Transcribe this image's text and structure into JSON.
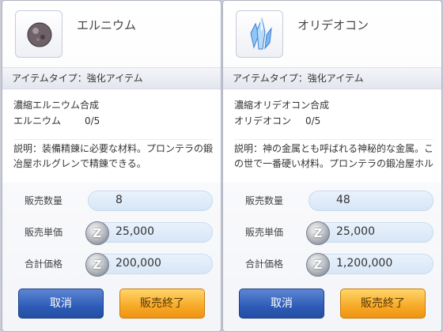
{
  "panels": [
    {
      "item_name": "エルニウム",
      "item_icon": "elunium-ore-icon",
      "type_line": "アイテムタイプ：強化アイテム",
      "refine_title": "濃縮エルニウム合成",
      "requirement_name": "エルニウム",
      "requirement_count": "0/5",
      "description": "説明：装備精錬に必要な材料。プロンテラの鍛冶屋ホルグレンで精錬できる。",
      "sale_qty_label": "販売数量",
      "sale_qty": "8",
      "unit_price_label": "販売単価",
      "unit_price": "25,000",
      "total_label": "合計価格",
      "total": "200,000",
      "cancel_label": "取消",
      "confirm_label": "販売終了"
    },
    {
      "item_name": "オリデオコン",
      "item_icon": "oridecon-crystal-icon",
      "type_line": "アイテムタイプ：強化アイテム",
      "refine_title": "濃縮オリデオコン合成",
      "requirement_name": "オリデオコン",
      "requirement_count": "0/5",
      "description": "説明：神の金属とも呼ばれる神秘的な金属。この世で一番硬い材料。プロンテラの鍛冶屋ホルグレンで精錬できる。",
      "sale_qty_label": "販売数量",
      "sale_qty": "48",
      "unit_price_label": "販売単価",
      "unit_price": "25,000",
      "total_label": "合計価格",
      "total": "1,200,000",
      "cancel_label": "取消",
      "confirm_label": "販売終了"
    }
  ],
  "currency_icon": "zeny-coin-icon",
  "currency_glyph": "Z"
}
